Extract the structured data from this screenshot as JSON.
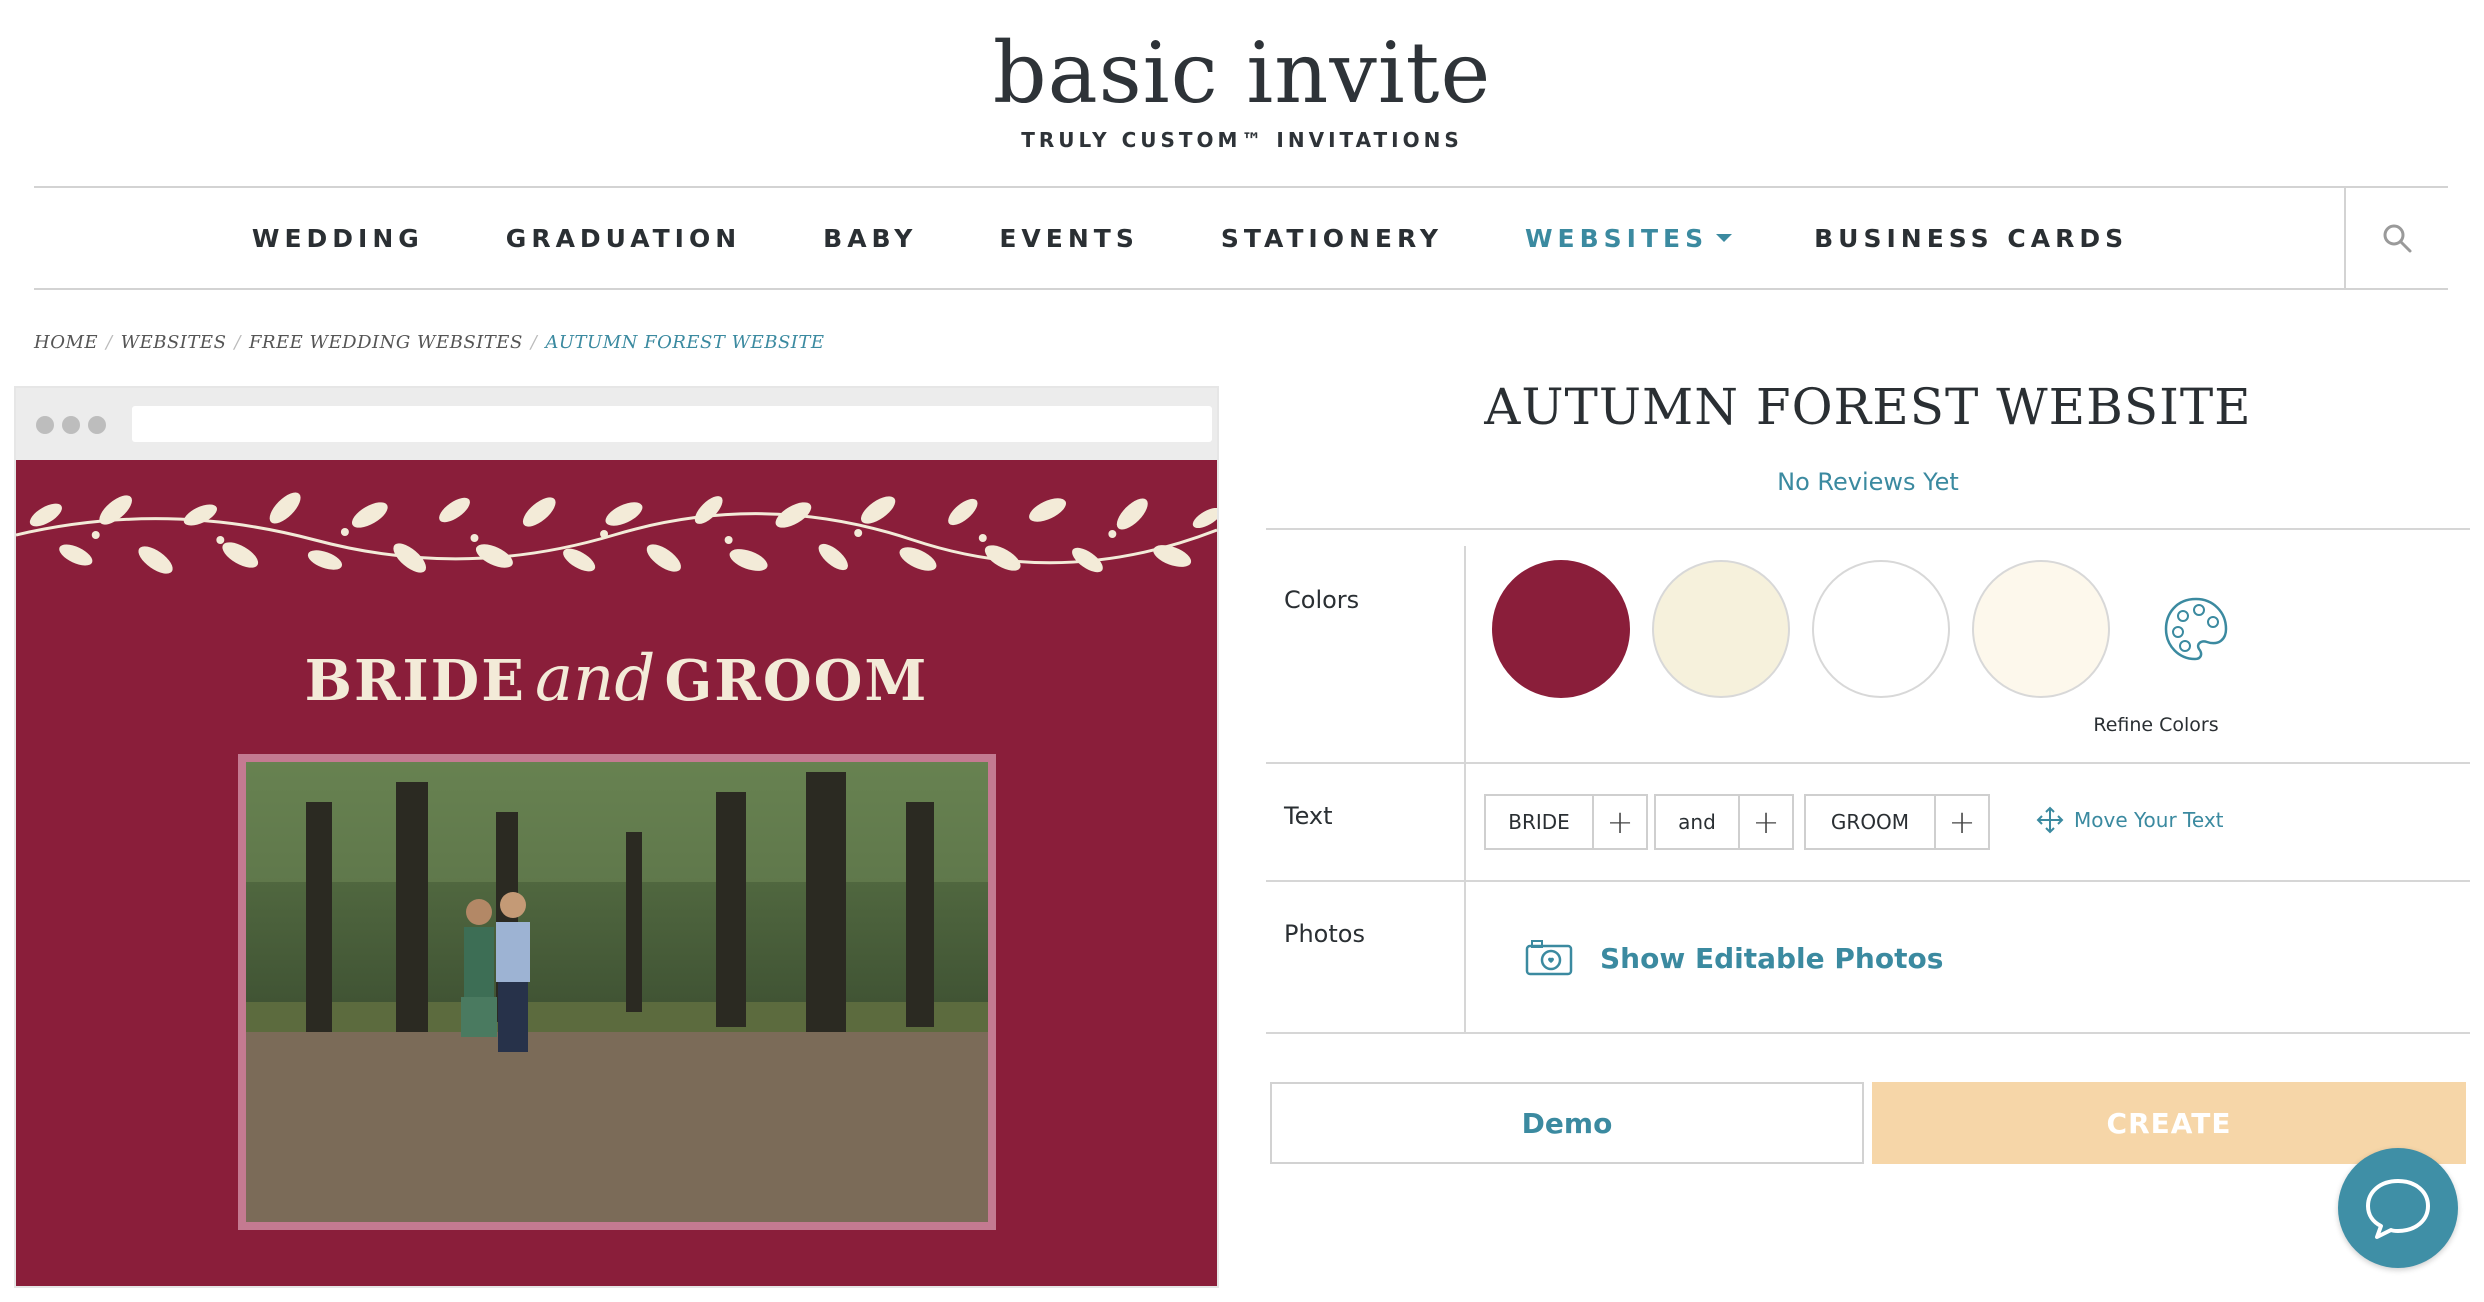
{
  "header": {
    "logo_text": "basic invite",
    "tagline": "TRULY CUSTOM™ INVITATIONS"
  },
  "nav": {
    "items": [
      {
        "label": "WEDDING"
      },
      {
        "label": "GRADUATION"
      },
      {
        "label": "BABY"
      },
      {
        "label": "EVENTS"
      },
      {
        "label": "STATIONERY"
      },
      {
        "label": "WEBSITES",
        "active": true
      },
      {
        "label": "BUSINESS CARDS"
      }
    ],
    "search_icon": "search-icon"
  },
  "breadcrumb": {
    "items": [
      "HOME",
      "WEBSITES",
      "FREE WEDDING WEBSITES"
    ],
    "current": "AUTUMN FOREST WEBSITE"
  },
  "preview": {
    "name_left": "BRIDE",
    "name_middle": "and",
    "name_right": "GROOM",
    "bg_color": "#8a1e3a",
    "accent_color": "#f3ebd8"
  },
  "product": {
    "title": "AUTUMN FOREST WEBSITE",
    "reviews": "No Reviews Yet"
  },
  "options": {
    "colors": {
      "label": "Colors",
      "swatches": [
        "#8a1e3a",
        "#f6f1dc",
        "#ffffff",
        "#fdf8ec"
      ],
      "refine_label": "Refine Colors"
    },
    "text": {
      "label": "Text",
      "fields": [
        "BRIDE",
        "and",
        "GROOM"
      ],
      "move_label": "Move Your Text"
    },
    "photos": {
      "label": "Photos",
      "show_label": "Show Editable Photos"
    }
  },
  "actions": {
    "demo_label": "Demo",
    "create_label": "CREATE"
  },
  "colors": {
    "accent": "#3b8aa0",
    "create_button": "#f6d6a8"
  }
}
